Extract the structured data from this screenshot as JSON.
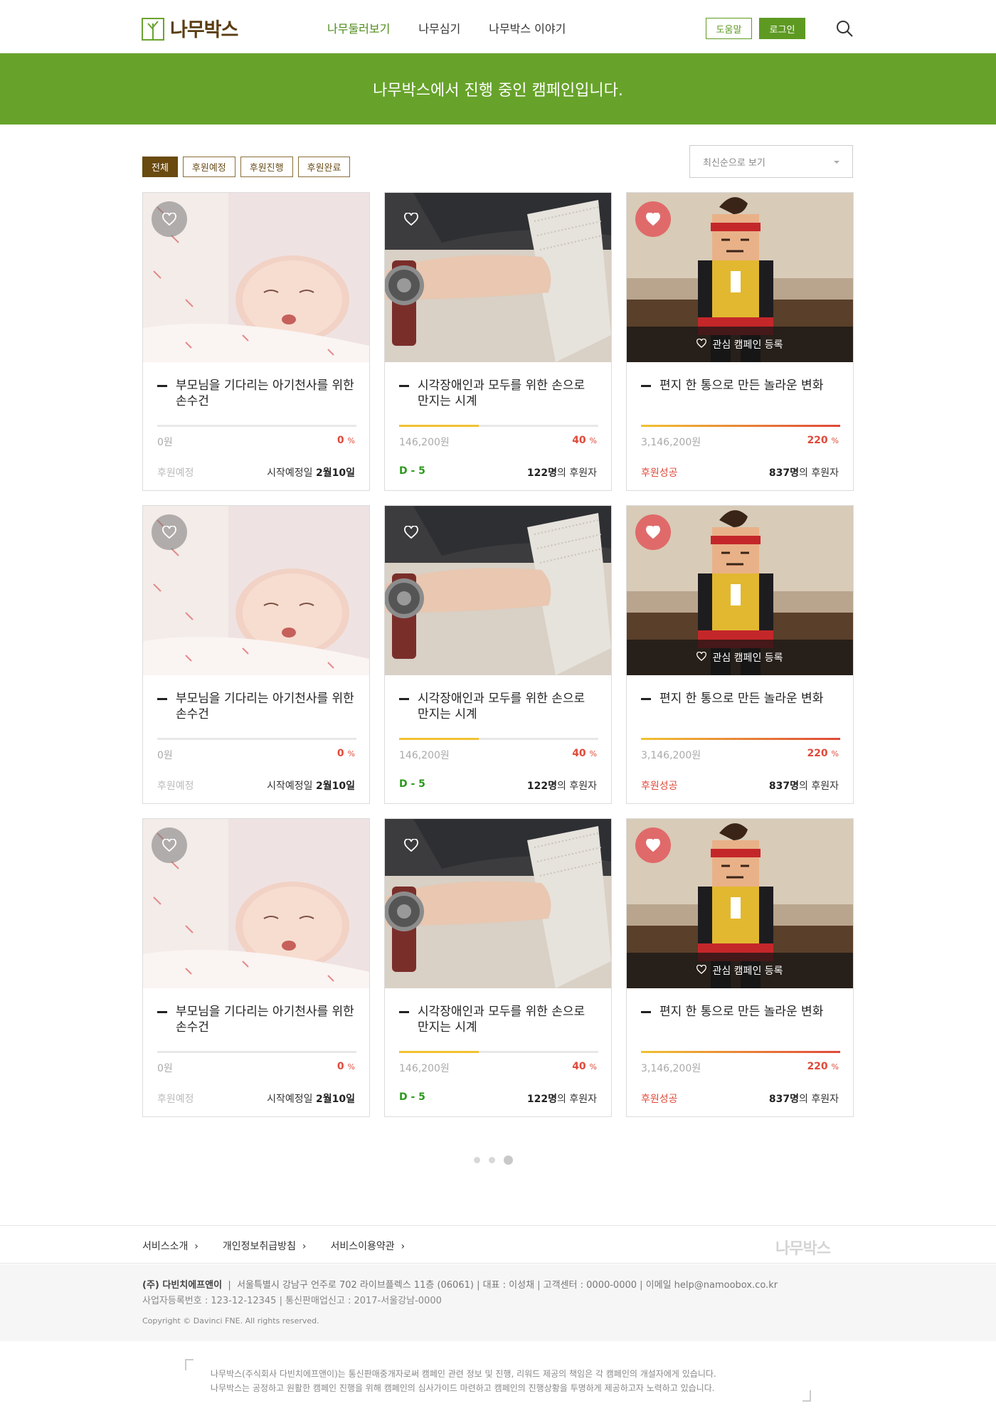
{
  "header": {
    "logo_text": "나무박스",
    "nav": [
      "나무둘러보기",
      "나무심기",
      "나무박스 이야기"
    ],
    "help_label": "도움말",
    "login_label": "로그인"
  },
  "banner": {
    "text": "나무박스에서 진행 중인 캠페인입니다."
  },
  "filters": [
    "전체",
    "후원예정",
    "후원진행",
    "후원완료"
  ],
  "sort": {
    "selected": "최신순으로 보기"
  },
  "wish_label": "관심 캠페인 등록",
  "cards": [
    {
      "image": "baby-photo",
      "title": "부모님을 기다리는 아기천사를 위한 손수건",
      "amount": "0원",
      "percent": "0",
      "percent_unit": "%",
      "progress": 0,
      "status": "후원예정",
      "meta_pre": "시작예정일",
      "meta_bold": "2월10일",
      "meta_post": "",
      "heart": "grey",
      "wish": false
    },
    {
      "image": "braille-watch-photo",
      "title": "시각장애인과 모두를 위한 손으로 만지는 시계",
      "amount": "146,200원",
      "percent": "40",
      "percent_unit": "%",
      "progress": 0.4,
      "status": "D - 5",
      "meta_pre": "",
      "meta_bold": "122명",
      "meta_post": "의 후원자",
      "heart": "none",
      "wish": false
    },
    {
      "image": "paper-toy-photo",
      "title": "편지 한 통으로 만든 놀라운 변화",
      "amount": "3,146,200원",
      "percent": "220",
      "percent_unit": "%",
      "progress": 1,
      "status": "후원성공",
      "meta_pre": "",
      "meta_bold": "837명",
      "meta_post": "의 후원자",
      "heart": "red",
      "wish": true
    },
    {
      "image": "baby-photo",
      "title": "부모님을 기다리는 아기천사를 위한 손수건",
      "amount": "0원",
      "percent": "0",
      "percent_unit": "%",
      "progress": 0,
      "status": "후원예정",
      "meta_pre": "시작예정일",
      "meta_bold": "2월10일",
      "meta_post": "",
      "heart": "grey",
      "wish": false
    },
    {
      "image": "braille-watch-photo",
      "title": "시각장애인과 모두를 위한 손으로 만지는 시계",
      "amount": "146,200원",
      "percent": "40",
      "percent_unit": "%",
      "progress": 0.4,
      "status": "D - 5",
      "meta_pre": "",
      "meta_bold": "122명",
      "meta_post": "의 후원자",
      "heart": "none",
      "wish": false
    },
    {
      "image": "paper-toy-photo",
      "title": "편지 한 통으로 만든 놀라운 변화",
      "amount": "3,146,200원",
      "percent": "220",
      "percent_unit": "%",
      "progress": 1,
      "status": "후원성공",
      "meta_pre": "",
      "meta_bold": "837명",
      "meta_post": "의 후원자",
      "heart": "red",
      "wish": true
    },
    {
      "image": "baby-photo",
      "title": "부모님을 기다리는 아기천사를 위한 손수건",
      "amount": "0원",
      "percent": "0",
      "percent_unit": "%",
      "progress": 0,
      "status": "후원예정",
      "meta_pre": "시작예정일",
      "meta_bold": "2월10일",
      "meta_post": "",
      "heart": "grey",
      "wish": false
    },
    {
      "image": "braille-watch-photo",
      "title": "시각장애인과 모두를 위한 손으로 만지는 시계",
      "amount": "146,200원",
      "percent": "40",
      "percent_unit": "%",
      "progress": 0.4,
      "status": "D - 5",
      "meta_pre": "",
      "meta_bold": "122명",
      "meta_post": "의 후원자",
      "heart": "none",
      "wish": false
    },
    {
      "image": "paper-toy-photo",
      "title": "편지 한 통으로 만든 놀라운 변화",
      "amount": "3,146,200원",
      "percent": "220",
      "percent_unit": "%",
      "progress": 1,
      "status": "후원성공",
      "meta_pre": "",
      "meta_bold": "837명",
      "meta_post": "의 후원자",
      "heart": "red",
      "wish": true
    }
  ],
  "pager": {
    "pages": 3,
    "current": 3
  },
  "footer": {
    "links": [
      "서비스소개",
      "개인정보취급방침",
      "서비스이용약관"
    ],
    "logo_text": "나무박스",
    "company": "(주) 다빈치에프앤이",
    "info1": "서울특별시 강남구 언주로 702 라이브플렉스 11층 (06061)  |  대표 : 이성채  |  고객센터 : 0000-0000  |  이메일 help@namoobox.co.kr",
    "info2": "사업자등록번호 : 123-12-12345  |  통신판매업신고 : 2017-서울강남-0000",
    "copyright": "Copyright © Davinci FNE. All rights reserved.",
    "notice1": "나무박스(주식회사 다빈치에프앤이)는 통신판매중개자로써 캠페인 관련 정보 및 진행, 리워드 제공의 책임은 각 캠페인의 개설자에게 있습니다.",
    "notice2": "나무박스는 공정하고 원활한 캠페인 진행을 위해 캠페인의 심사가이드 마련하고 캠페인의 진행상황을 투명하게 제공하고자 노력하고 있습니다."
  },
  "colors": {
    "brand_green": "#67a32a",
    "brand_brown": "#6a4a0e",
    "accent_red": "#e04a3a",
    "success_green": "#2a9a1a"
  }
}
